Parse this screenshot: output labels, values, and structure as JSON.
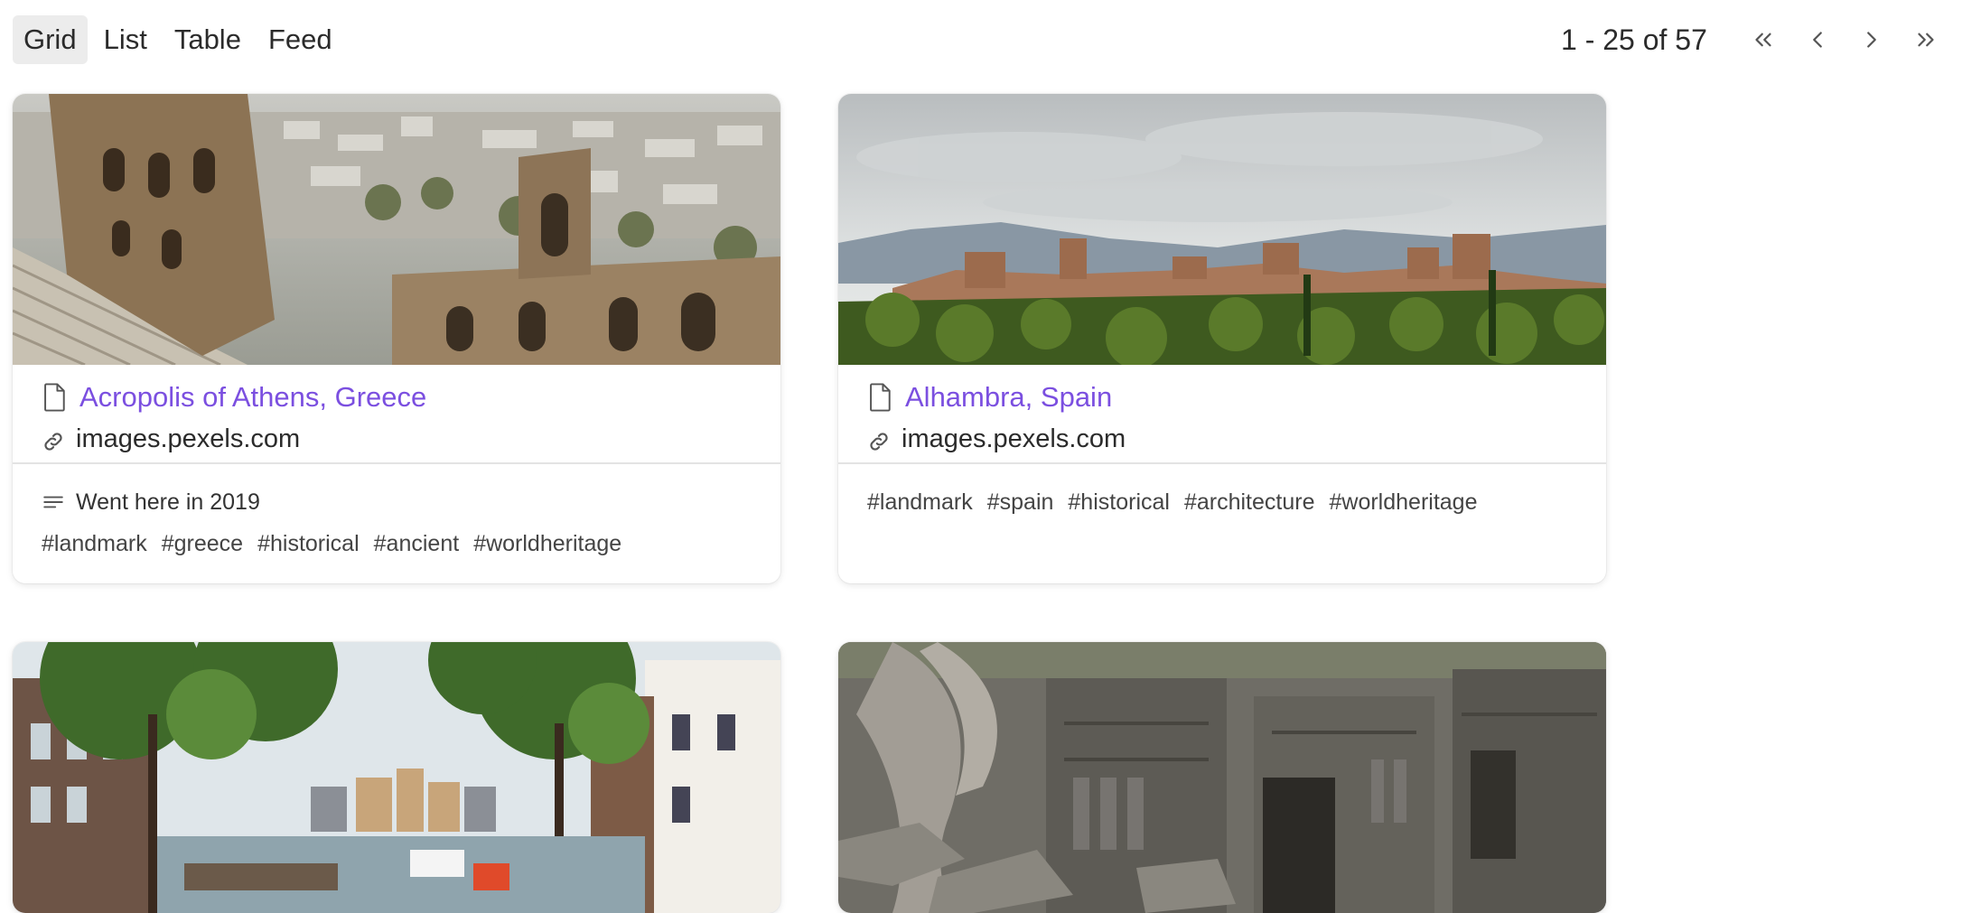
{
  "toolbar": {
    "views": [
      "Grid",
      "List",
      "Table",
      "Feed"
    ],
    "active_view": "Grid",
    "pagination": "1 - 25 of 57"
  },
  "cards": [
    {
      "title": "Acropolis of Athens, Greece",
      "url": "images.pexels.com",
      "note": "Went here in 2019",
      "tags": [
        "#landmark",
        "#greece",
        "#historical",
        "#ancient",
        "#worldheritage"
      ]
    },
    {
      "title": "Alhambra, Spain",
      "url": "images.pexels.com",
      "note": "",
      "tags": [
        "#landmark",
        "#spain",
        "#historical",
        "#architecture",
        "#worldheritage"
      ]
    }
  ],
  "colors": {
    "link": "#7b4fe0",
    "active_tab_bg": "#ececec",
    "divider": "#e3e3e3"
  }
}
